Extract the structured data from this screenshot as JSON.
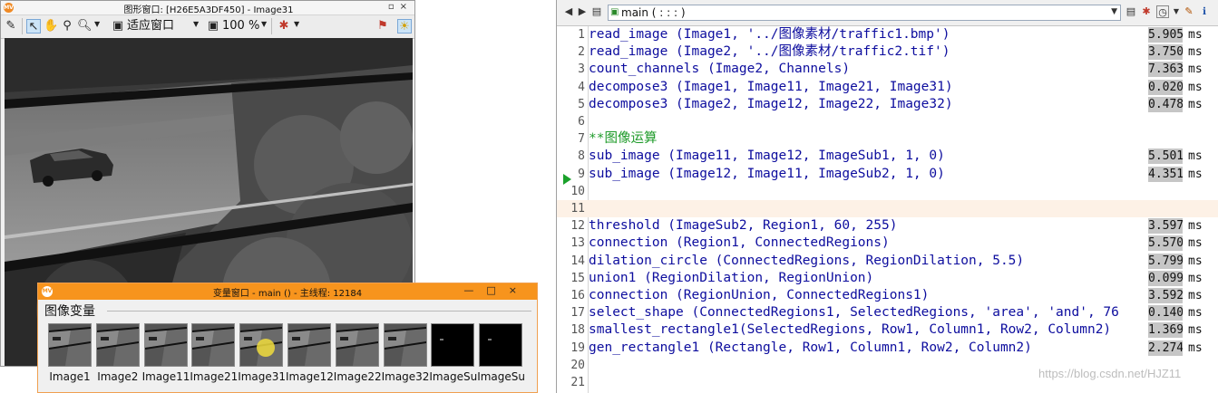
{
  "graphics_window": {
    "title": "图形窗口: [H26E5A3DF450] - Image31",
    "app_icon": "MV",
    "toolbar": {
      "fit_label": "适应窗口",
      "zoom_label": "100 %"
    },
    "icons": [
      "edit-icon",
      "pointer-icon",
      "hand-icon",
      "zoom-icon",
      "magnify-icon",
      "fit-window-icon",
      "zoom-percent-icon",
      "color-icon",
      "pin-icon",
      "help-icon"
    ]
  },
  "variable_window": {
    "title": "变量窗口 - main () - 主线程: 12184",
    "app_icon": "MV",
    "heading": "图像变量",
    "thumbnails": [
      {
        "label": "Image1",
        "kind": "photo"
      },
      {
        "label": "Image2",
        "kind": "photo"
      },
      {
        "label": "Image11",
        "kind": "photo"
      },
      {
        "label": "Image21",
        "kind": "photo"
      },
      {
        "label": "Image31",
        "kind": "photo-cursor"
      },
      {
        "label": "Image12",
        "kind": "photo"
      },
      {
        "label": "Image22",
        "kind": "photo"
      },
      {
        "label": "Image32",
        "kind": "photo"
      },
      {
        "label": "ImageSu",
        "kind": "black"
      },
      {
        "label": "ImageSu",
        "kind": "black"
      }
    ]
  },
  "program_window": {
    "procedure": "main ( : : : )",
    "lines": [
      {
        "n": "1",
        "code": "read_image (Image1, '../图像素材/traffic1.bmp')",
        "time": "5.905",
        "unit": "ms"
      },
      {
        "n": "2",
        "code": "read_image (Image2, '../图像素材/traffic2.tif')",
        "time": "3.750",
        "unit": "ms"
      },
      {
        "n": "3",
        "code": "count_channels (Image2, Channels)",
        "time": "7.363",
        "unit": "ms"
      },
      {
        "n": "4",
        "code": "decompose3 (Image1, Image11, Image21, Image31)",
        "time": "0.020",
        "unit": "ms"
      },
      {
        "n": "5",
        "code": "decompose3 (Image2, Image12, Image22, Image32)",
        "time": "0.478",
        "unit": "ms"
      },
      {
        "n": "6",
        "code": "",
        "time": "",
        "unit": ""
      },
      {
        "n": "7",
        "code": "**图像运算",
        "time": "",
        "unit": "",
        "comment": true
      },
      {
        "n": "8",
        "code": "sub_image (Image11, Image12, ImageSub1, 1, 0)",
        "time": "5.501",
        "unit": "ms"
      },
      {
        "n": "9",
        "code": "sub_image (Image12, Image11, ImageSub2, 1, 0)",
        "time": "4.351",
        "unit": "ms"
      },
      {
        "n": "10",
        "code": "",
        "time": "",
        "unit": ""
      },
      {
        "n": "11",
        "code": "",
        "time": "",
        "unit": "",
        "current": true
      },
      {
        "n": "12",
        "code": "threshold (ImageSub2, Region1, 60, 255)",
        "time": "3.597",
        "unit": "ms"
      },
      {
        "n": "13",
        "code": "connection (Region1, ConnectedRegions)",
        "time": "5.570",
        "unit": "ms"
      },
      {
        "n": "14",
        "code": "dilation_circle (ConnectedRegions, RegionDilation, 5.5)",
        "time": "5.799",
        "unit": "ms"
      },
      {
        "n": "15",
        "code": "union1 (RegionDilation, RegionUnion)",
        "time": "0.099",
        "unit": "ms"
      },
      {
        "n": "16",
        "code": "connection (RegionUnion, ConnectedRegions1)",
        "time": "3.592",
        "unit": "ms"
      },
      {
        "n": "17",
        "code": "select_shape (ConnectedRegions1, SelectedRegions, 'area', 'and', 76",
        "time": "0.140",
        "unit": "ms"
      },
      {
        "n": "18",
        "code": "smallest_rectangle1(SelectedRegions, Row1, Column1, Row2, Column2)",
        "time": "1.369",
        "unit": "ms"
      },
      {
        "n": "19",
        "code": "gen_rectangle1 (Rectangle, Row1, Column1, Row2, Column2)",
        "time": "2.274",
        "unit": "ms"
      },
      {
        "n": "20",
        "code": "",
        "time": "",
        "unit": ""
      },
      {
        "n": "21",
        "code": "",
        "time": "",
        "unit": ""
      }
    ],
    "watermark": "https://blog.csdn.net/HJZ11"
  },
  "colors": {
    "accent_orange": "#f7941d",
    "code_blue": "#0d0d9e",
    "comment_green": "#1f9b2a",
    "pc_arrow": "#1aa12b"
  }
}
